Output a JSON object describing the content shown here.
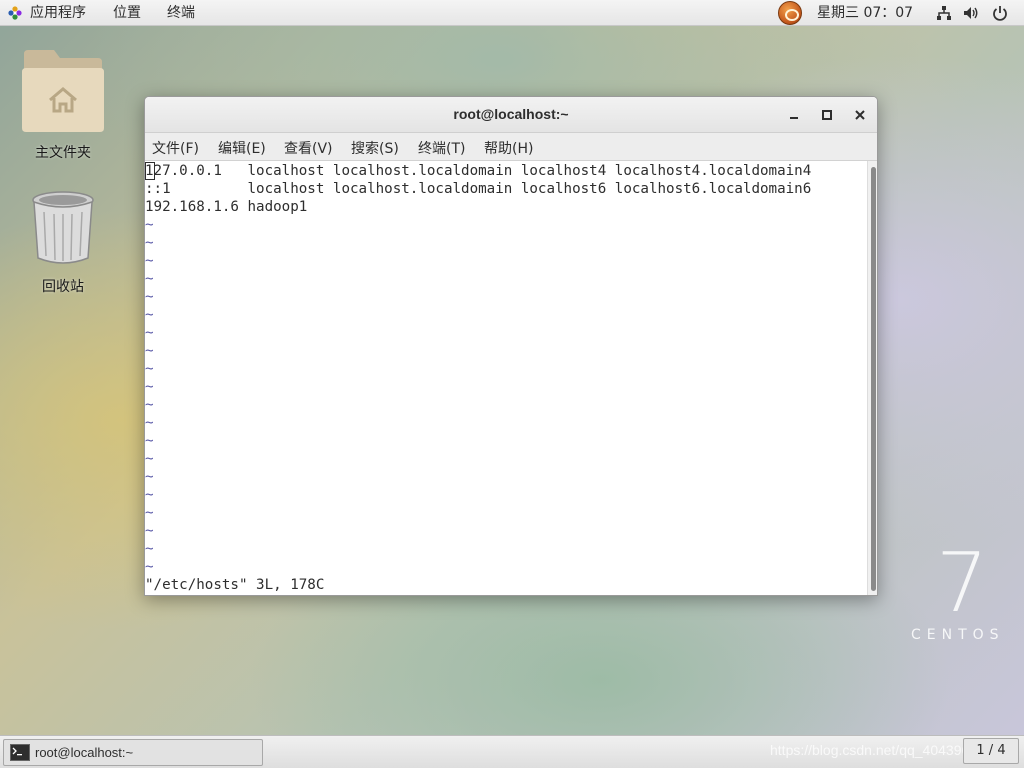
{
  "top_panel": {
    "apps_label": "应用程序",
    "places_label": "位置",
    "terminal_label": "终端",
    "clock": "星期三 07：07",
    "icons": [
      "apps-icon",
      "user-avatar-icon",
      "network-icon",
      "volume-icon",
      "power-icon"
    ]
  },
  "desktop": {
    "home_folder_label": "主文件夹",
    "trash_label": "回收站",
    "logo_number": "7",
    "logo_word": "CENTOS"
  },
  "window": {
    "title": "root@localhost:~",
    "menu": {
      "file": "文件(F)",
      "edit": "编辑(E)",
      "view": "查看(V)",
      "search": "搜索(S)",
      "terminal": "终端(T)",
      "help": "帮助(H)"
    },
    "terminal": {
      "lines": [
        "127.0.0.1   localhost localhost.localdomain localhost4 localhost4.localdomain4",
        "::1         localhost localhost.localdomain localhost6 localhost6.localdomain6",
        "192.168.1.6 hadoop1"
      ],
      "tilde": "~",
      "status": "\"/etc/hosts\" 3L, 178C"
    }
  },
  "bottom_panel": {
    "task_label": "root@localhost:~",
    "watermark": "https://blog.csdn.net/qq_40439654",
    "workspace": "1 / 4"
  },
  "colors": {
    "tilde": "#5a5aa8",
    "panel_bg": "#eaeaea",
    "window_bg": "#ffffff"
  }
}
